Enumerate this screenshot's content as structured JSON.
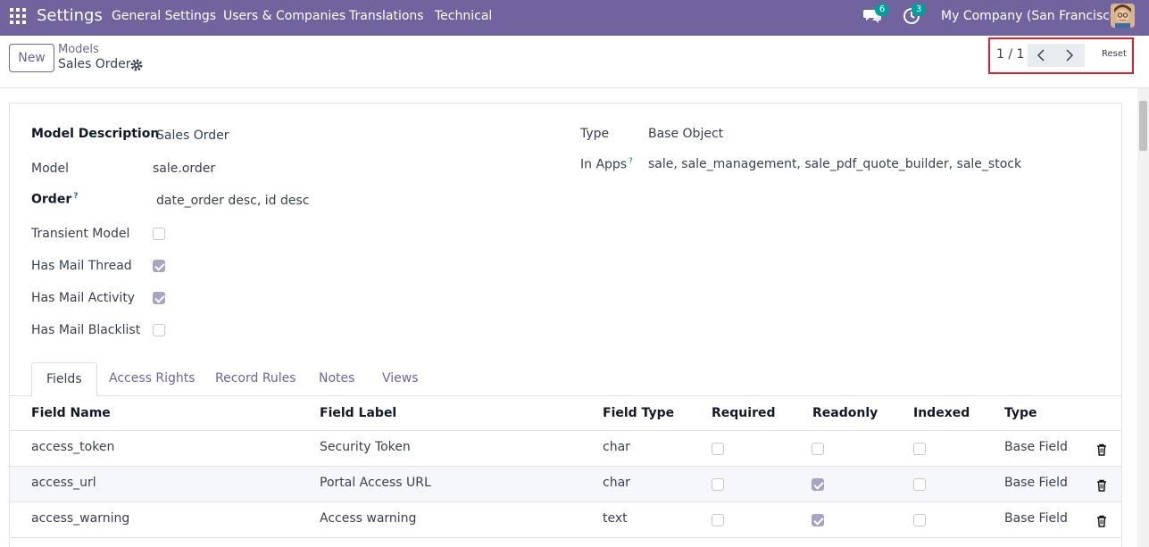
{
  "navbar": {
    "brand": "Settings",
    "menu": [
      "General Settings",
      "Users & Companies",
      "Translations",
      "Technical"
    ],
    "messages_count": "6",
    "activities_count": "3",
    "company": "My Company (San Francisco)",
    "apps_icon": "grid-icon",
    "messages_icon": "chat-bubbles-icon",
    "activities_icon": "clock-icon"
  },
  "control": {
    "new_label": "New",
    "breadcrumb_parent": "Models",
    "breadcrumb_current": "Sales Order",
    "pager_value": "1 / 1",
    "reset_label": "Reset"
  },
  "form": {
    "model_description_label": "Model Description",
    "model_description": "Sales Order",
    "model_label": "Model",
    "model": "sale.order",
    "order_label": "Order",
    "order_help": "?",
    "order": "date_order desc, id desc",
    "transient_label": "Transient Model",
    "transient": false,
    "mail_thread_label": "Has Mail Thread",
    "mail_thread": true,
    "mail_activity_label": "Has Mail Activity",
    "mail_activity": true,
    "mail_blacklist_label": "Has Mail Blacklist",
    "mail_blacklist": false,
    "type_label": "Type",
    "type": "Base Object",
    "in_apps_label": "In Apps",
    "in_apps_help": "?",
    "in_apps": "sale, sale_management, sale_pdf_quote_builder, sale_stock"
  },
  "tabs": [
    "Fields",
    "Access Rights",
    "Record Rules",
    "Notes",
    "Views"
  ],
  "table": {
    "headers": [
      "Field Name",
      "Field Label",
      "Field Type",
      "Required",
      "Readonly",
      "Indexed",
      "Type"
    ],
    "rows": [
      {
        "name": "access_token",
        "label": "Security Token",
        "ftype": "char",
        "required": false,
        "readonly": false,
        "indexed": false,
        "type": "Base Field"
      },
      {
        "name": "access_url",
        "label": "Portal Access URL",
        "ftype": "char",
        "required": false,
        "readonly": true,
        "indexed": false,
        "type": "Base Field"
      },
      {
        "name": "access_warning",
        "label": "Access warning",
        "ftype": "text",
        "required": false,
        "readonly": true,
        "indexed": false,
        "type": "Base Field"
      }
    ]
  },
  "colors": {
    "primary": "#71639e",
    "badge": "#00a09d",
    "highlight": "#d9202c"
  }
}
